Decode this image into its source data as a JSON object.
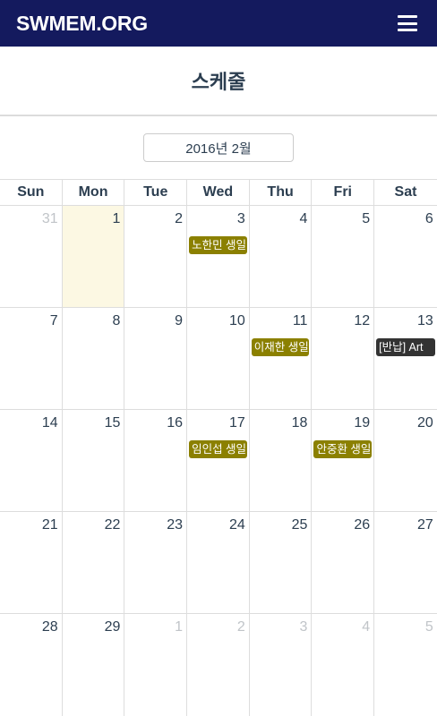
{
  "header": {
    "brand": "SWMEM.ORG",
    "menu_icon": "hamburger-menu-icon"
  },
  "page": {
    "title": "스케줄"
  },
  "calendar": {
    "month_label": "2016년 2월",
    "weekdays": [
      "Sun",
      "Mon",
      "Tue",
      "Wed",
      "Thu",
      "Fri",
      "Sat"
    ],
    "colors": {
      "birthday": "#8b8000",
      "return": "#333333",
      "today_bg": "#fcf8e3"
    },
    "weeks": [
      [
        {
          "day": "31",
          "other": true
        },
        {
          "day": "1",
          "today": true
        },
        {
          "day": "2"
        },
        {
          "day": "3",
          "event": "노한민 생일",
          "event_color": "#8b8000"
        },
        {
          "day": "4"
        },
        {
          "day": "5"
        },
        {
          "day": "6"
        }
      ],
      [
        {
          "day": "7"
        },
        {
          "day": "8"
        },
        {
          "day": "9"
        },
        {
          "day": "10"
        },
        {
          "day": "11",
          "event": "이재한 생일",
          "event_color": "#8b8000"
        },
        {
          "day": "12"
        },
        {
          "day": "13",
          "event": "[반납] Art",
          "event_color": "#333333"
        }
      ],
      [
        {
          "day": "14"
        },
        {
          "day": "15"
        },
        {
          "day": "16"
        },
        {
          "day": "17",
          "event": "임인섭 생일",
          "event_color": "#8b8000"
        },
        {
          "day": "18"
        },
        {
          "day": "19",
          "event": "안중환 생일",
          "event_color": "#8b8000"
        },
        {
          "day": "20"
        }
      ],
      [
        {
          "day": "21"
        },
        {
          "day": "22"
        },
        {
          "day": "23"
        },
        {
          "day": "24"
        },
        {
          "day": "25"
        },
        {
          "day": "26"
        },
        {
          "day": "27"
        }
      ],
      [
        {
          "day": "28"
        },
        {
          "day": "29"
        },
        {
          "day": "1",
          "other": true
        },
        {
          "day": "2",
          "other": true
        },
        {
          "day": "3",
          "other": true
        },
        {
          "day": "4",
          "other": true
        },
        {
          "day": "5",
          "other": true
        }
      ]
    ]
  }
}
